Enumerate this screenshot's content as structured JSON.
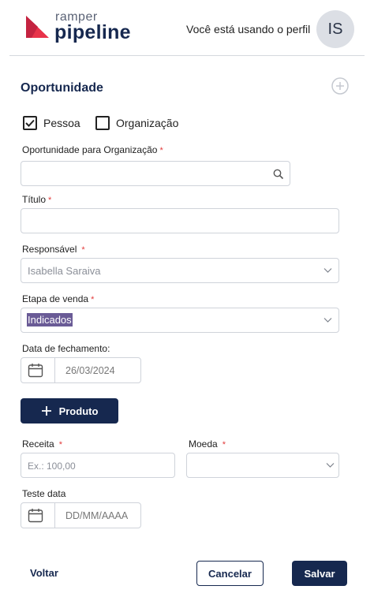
{
  "brand": {
    "top": "ramper",
    "bottom": "pipeline"
  },
  "header": {
    "profile_text": "Você está usando o perfil",
    "avatar_initials": "IS"
  },
  "form": {
    "title": "Oportunidade",
    "checkbox_person": {
      "label": "Pessoa",
      "checked": true
    },
    "checkbox_org": {
      "label": "Organização",
      "checked": false
    },
    "org_field": {
      "label": "Oportunidade para Organização",
      "required": "*",
      "value": ""
    },
    "title_field": {
      "label": "Título",
      "required": "*",
      "value": ""
    },
    "responsavel": {
      "label": "Responsável",
      "required": "*",
      "value": "Isabella Saraiva"
    },
    "etapa": {
      "label": "Etapa de venda",
      "required": "*",
      "value": "Indicados"
    },
    "fechamento": {
      "label": "Data de fechamento:",
      "value": "26/03/2024"
    },
    "produto_button": "Produto",
    "receita": {
      "label": "Receita",
      "required": "*",
      "placeholder": "Ex.: 100,00"
    },
    "moeda": {
      "label": "Moeda",
      "required": "*",
      "value": ""
    },
    "teste_data": {
      "label": "Teste data",
      "placeholder": "DD/MM/AAAA"
    }
  },
  "footer": {
    "back": "Voltar",
    "cancel": "Cancelar",
    "save": "Salvar"
  },
  "colors": {
    "navy": "#16284f",
    "brand_red": "#e8334a",
    "selection": "#6a5b96"
  }
}
